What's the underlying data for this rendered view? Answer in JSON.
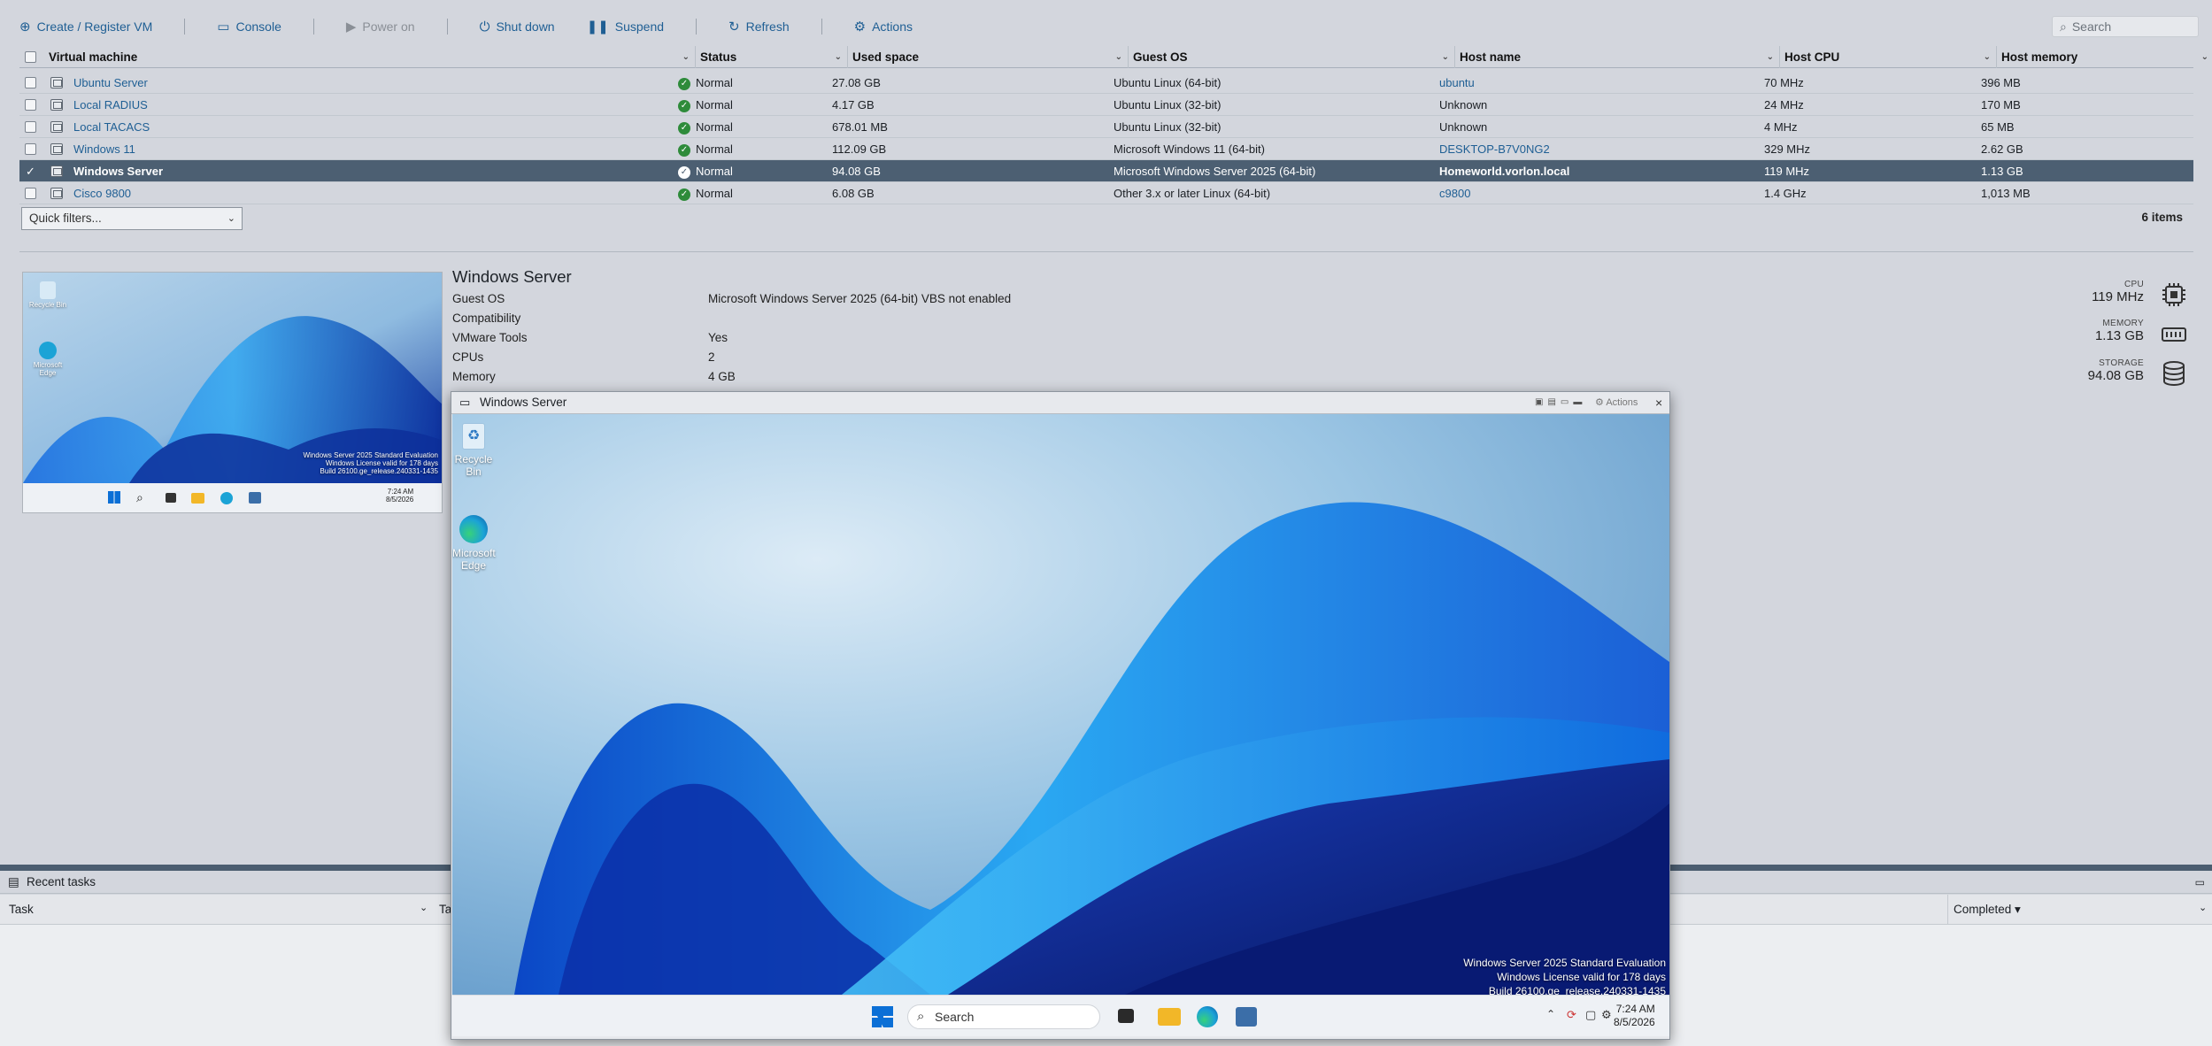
{
  "toolbar": {
    "create": "Create / Register VM",
    "console": "Console",
    "power_on": "Power on",
    "shutdown": "Shut down",
    "suspend": "Suspend",
    "refresh": "Refresh",
    "actions": "Actions",
    "search_placeholder": "Search"
  },
  "table": {
    "headers": [
      "Virtual machine",
      "Status",
      "Used space",
      "Guest OS",
      "Host name",
      "Host CPU",
      "Host memory"
    ],
    "rows": [
      {
        "name": "Ubuntu Server",
        "status": "Normal",
        "used": "27.08 GB",
        "os": "Ubuntu Linux (64-bit)",
        "host": "ubuntu",
        "cpu": "70 MHz",
        "mem": "396 MB"
      },
      {
        "name": "Local RADIUS",
        "status": "Normal",
        "used": "4.17 GB",
        "os": "Ubuntu Linux (32-bit)",
        "host": "Unknown",
        "cpu": "24 MHz",
        "mem": "170 MB"
      },
      {
        "name": "Local TACACS",
        "status": "Normal",
        "used": "678.01 MB",
        "os": "Ubuntu Linux (32-bit)",
        "host": "Unknown",
        "cpu": "4 MHz",
        "mem": "65 MB"
      },
      {
        "name": "Windows 11",
        "status": "Normal",
        "used": "112.09 GB",
        "os": "Microsoft Windows 11 (64-bit)",
        "host": "DESKTOP-B7V0NG2",
        "cpu": "329 MHz",
        "mem": "2.62 GB"
      },
      {
        "name": "Windows Server",
        "status": "Normal",
        "used": "94.08 GB",
        "os": "Microsoft Windows Server 2025 (64-bit)",
        "host": "Homeworld.vorlon.local",
        "cpu": "119 MHz",
        "mem": "1.13 GB"
      },
      {
        "name": "Cisco 9800",
        "status": "Normal",
        "used": "6.08 GB",
        "os": "Other 3.x or later Linux (64-bit)",
        "host": "c9800",
        "cpu": "1.4 GHz",
        "mem": "1,013 MB"
      }
    ],
    "quick_filters": "Quick filters...",
    "items_count": "6 items"
  },
  "detail": {
    "title": "Windows Server",
    "props": [
      {
        "label": "Guest OS",
        "value": "Microsoft Windows Server 2025 (64-bit) VBS not enabled"
      },
      {
        "label": "Compatibility",
        "value": ""
      },
      {
        "label": "VMware Tools",
        "value": "Yes"
      },
      {
        "label": "CPUs",
        "value": "2"
      },
      {
        "label": "Memory",
        "value": "4 GB"
      }
    ],
    "stats": [
      {
        "label": "CPU",
        "value": "119 MHz"
      },
      {
        "label": "MEMORY",
        "value": "1.13 GB"
      },
      {
        "label": "STORAGE",
        "value": "94.08 GB"
      }
    ]
  },
  "thumbnail": {
    "recycle": "Recycle Bin",
    "edge": "Microsoft Edge",
    "wm1": "Windows Server 2025 Standard Evaluation",
    "wm2": "Windows License valid for 178 days",
    "wm3": "Build 26100.ge_release.240331-1435",
    "time": "7:24 AM",
    "date": "8/5/2026"
  },
  "recent_tasks": {
    "title": "Recent tasks",
    "col_task": "Task",
    "col_ta": "Ta",
    "col_completed": "Completed ▾"
  },
  "console": {
    "title": "Windows Server",
    "actions": "Actions",
    "recycle": "Recycle Bin",
    "edge_line1": "Microsoft",
    "edge_line2": "Edge",
    "wm1": "Windows Server 2025 Standard Evaluation",
    "wm2": "Windows License valid for 178 days",
    "wm3": "Build 26100.ge_release.240331-1435",
    "search": "Search",
    "time": "7:24 AM",
    "date": "8/5/2026"
  },
  "colors": {
    "link": "#1f5f94",
    "selected_row": "#4c5f72",
    "status_ok": "#2e8b3a"
  }
}
